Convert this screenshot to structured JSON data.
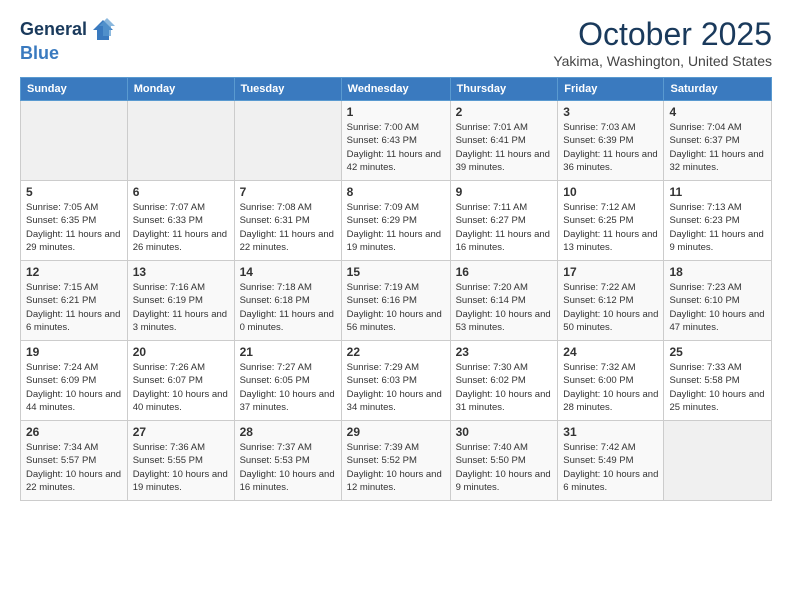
{
  "header": {
    "logo_line1": "General",
    "logo_line2": "Blue",
    "month": "October 2025",
    "location": "Yakima, Washington, United States"
  },
  "days_of_week": [
    "Sunday",
    "Monday",
    "Tuesday",
    "Wednesday",
    "Thursday",
    "Friday",
    "Saturday"
  ],
  "weeks": [
    [
      {
        "num": "",
        "empty": true
      },
      {
        "num": "",
        "empty": true
      },
      {
        "num": "",
        "empty": true
      },
      {
        "num": "1",
        "sunrise": "7:00 AM",
        "sunset": "6:43 PM",
        "daylight": "11 hours and 42 minutes."
      },
      {
        "num": "2",
        "sunrise": "7:01 AM",
        "sunset": "6:41 PM",
        "daylight": "11 hours and 39 minutes."
      },
      {
        "num": "3",
        "sunrise": "7:03 AM",
        "sunset": "6:39 PM",
        "daylight": "11 hours and 36 minutes."
      },
      {
        "num": "4",
        "sunrise": "7:04 AM",
        "sunset": "6:37 PM",
        "daylight": "11 hours and 32 minutes."
      }
    ],
    [
      {
        "num": "5",
        "sunrise": "7:05 AM",
        "sunset": "6:35 PM",
        "daylight": "11 hours and 29 minutes."
      },
      {
        "num": "6",
        "sunrise": "7:07 AM",
        "sunset": "6:33 PM",
        "daylight": "11 hours and 26 minutes."
      },
      {
        "num": "7",
        "sunrise": "7:08 AM",
        "sunset": "6:31 PM",
        "daylight": "11 hours and 22 minutes."
      },
      {
        "num": "8",
        "sunrise": "7:09 AM",
        "sunset": "6:29 PM",
        "daylight": "11 hours and 19 minutes."
      },
      {
        "num": "9",
        "sunrise": "7:11 AM",
        "sunset": "6:27 PM",
        "daylight": "11 hours and 16 minutes."
      },
      {
        "num": "10",
        "sunrise": "7:12 AM",
        "sunset": "6:25 PM",
        "daylight": "11 hours and 13 minutes."
      },
      {
        "num": "11",
        "sunrise": "7:13 AM",
        "sunset": "6:23 PM",
        "daylight": "11 hours and 9 minutes."
      }
    ],
    [
      {
        "num": "12",
        "sunrise": "7:15 AM",
        "sunset": "6:21 PM",
        "daylight": "11 hours and 6 minutes."
      },
      {
        "num": "13",
        "sunrise": "7:16 AM",
        "sunset": "6:19 PM",
        "daylight": "11 hours and 3 minutes."
      },
      {
        "num": "14",
        "sunrise": "7:18 AM",
        "sunset": "6:18 PM",
        "daylight": "11 hours and 0 minutes."
      },
      {
        "num": "15",
        "sunrise": "7:19 AM",
        "sunset": "6:16 PM",
        "daylight": "10 hours and 56 minutes."
      },
      {
        "num": "16",
        "sunrise": "7:20 AM",
        "sunset": "6:14 PM",
        "daylight": "10 hours and 53 minutes."
      },
      {
        "num": "17",
        "sunrise": "7:22 AM",
        "sunset": "6:12 PM",
        "daylight": "10 hours and 50 minutes."
      },
      {
        "num": "18",
        "sunrise": "7:23 AM",
        "sunset": "6:10 PM",
        "daylight": "10 hours and 47 minutes."
      }
    ],
    [
      {
        "num": "19",
        "sunrise": "7:24 AM",
        "sunset": "6:09 PM",
        "daylight": "10 hours and 44 minutes."
      },
      {
        "num": "20",
        "sunrise": "7:26 AM",
        "sunset": "6:07 PM",
        "daylight": "10 hours and 40 minutes."
      },
      {
        "num": "21",
        "sunrise": "7:27 AM",
        "sunset": "6:05 PM",
        "daylight": "10 hours and 37 minutes."
      },
      {
        "num": "22",
        "sunrise": "7:29 AM",
        "sunset": "6:03 PM",
        "daylight": "10 hours and 34 minutes."
      },
      {
        "num": "23",
        "sunrise": "7:30 AM",
        "sunset": "6:02 PM",
        "daylight": "10 hours and 31 minutes."
      },
      {
        "num": "24",
        "sunrise": "7:32 AM",
        "sunset": "6:00 PM",
        "daylight": "10 hours and 28 minutes."
      },
      {
        "num": "25",
        "sunrise": "7:33 AM",
        "sunset": "5:58 PM",
        "daylight": "10 hours and 25 minutes."
      }
    ],
    [
      {
        "num": "26",
        "sunrise": "7:34 AM",
        "sunset": "5:57 PM",
        "daylight": "10 hours and 22 minutes."
      },
      {
        "num": "27",
        "sunrise": "7:36 AM",
        "sunset": "5:55 PM",
        "daylight": "10 hours and 19 minutes."
      },
      {
        "num": "28",
        "sunrise": "7:37 AM",
        "sunset": "5:53 PM",
        "daylight": "10 hours and 16 minutes."
      },
      {
        "num": "29",
        "sunrise": "7:39 AM",
        "sunset": "5:52 PM",
        "daylight": "10 hours and 12 minutes."
      },
      {
        "num": "30",
        "sunrise": "7:40 AM",
        "sunset": "5:50 PM",
        "daylight": "10 hours and 9 minutes."
      },
      {
        "num": "31",
        "sunrise": "7:42 AM",
        "sunset": "5:49 PM",
        "daylight": "10 hours and 6 minutes."
      },
      {
        "num": "",
        "empty": true
      }
    ]
  ]
}
